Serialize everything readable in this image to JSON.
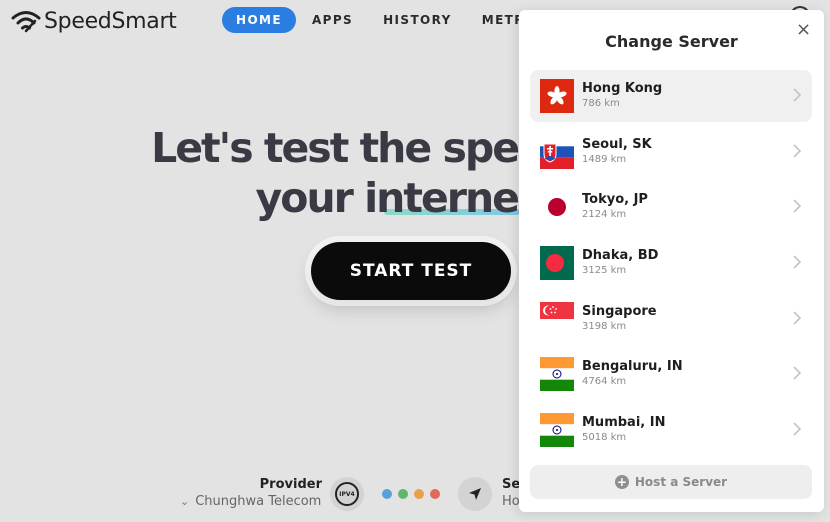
{
  "header": {
    "brand": "SpeedSmart",
    "nav": [
      {
        "label": "HOME",
        "active": true
      },
      {
        "label": "APPS",
        "active": false
      },
      {
        "label": "HISTORY",
        "active": false
      },
      {
        "label": "METRICS",
        "active": false
      }
    ]
  },
  "hero": {
    "line1": "Let's test the spe",
    "line2": "your interne",
    "start_button": "START TEST"
  },
  "footer": {
    "provider_title": "Provider",
    "provider_value": "Chunghwa Telecom",
    "ip_badge": "IPV4",
    "server_title": "Se",
    "server_value": "Ho"
  },
  "modal": {
    "title": "Change Server",
    "close": "×",
    "host_button": "Host a Server",
    "servers": [
      {
        "city": "Hong Kong",
        "distance": "786 km",
        "flag": "hk",
        "selected": true
      },
      {
        "city": "Seoul, SK",
        "distance": "1489 km",
        "flag": "sk",
        "selected": false
      },
      {
        "city": "Tokyo, JP",
        "distance": "2124 km",
        "flag": "jp",
        "selected": false
      },
      {
        "city": "Dhaka, BD",
        "distance": "3125 km",
        "flag": "bd",
        "selected": false
      },
      {
        "city": "Singapore",
        "distance": "3198 km",
        "flag": "sg",
        "selected": false
      },
      {
        "city": "Bengaluru, IN",
        "distance": "4764 km",
        "flag": "in",
        "selected": false
      },
      {
        "city": "Mumbai, IN",
        "distance": "5018 km",
        "flag": "in",
        "selected": false
      }
    ]
  },
  "colors": {
    "accent": "#2a7de1",
    "dots": [
      "#5aa0d8",
      "#5db86d",
      "#e8a04a",
      "#e06a5a"
    ]
  }
}
